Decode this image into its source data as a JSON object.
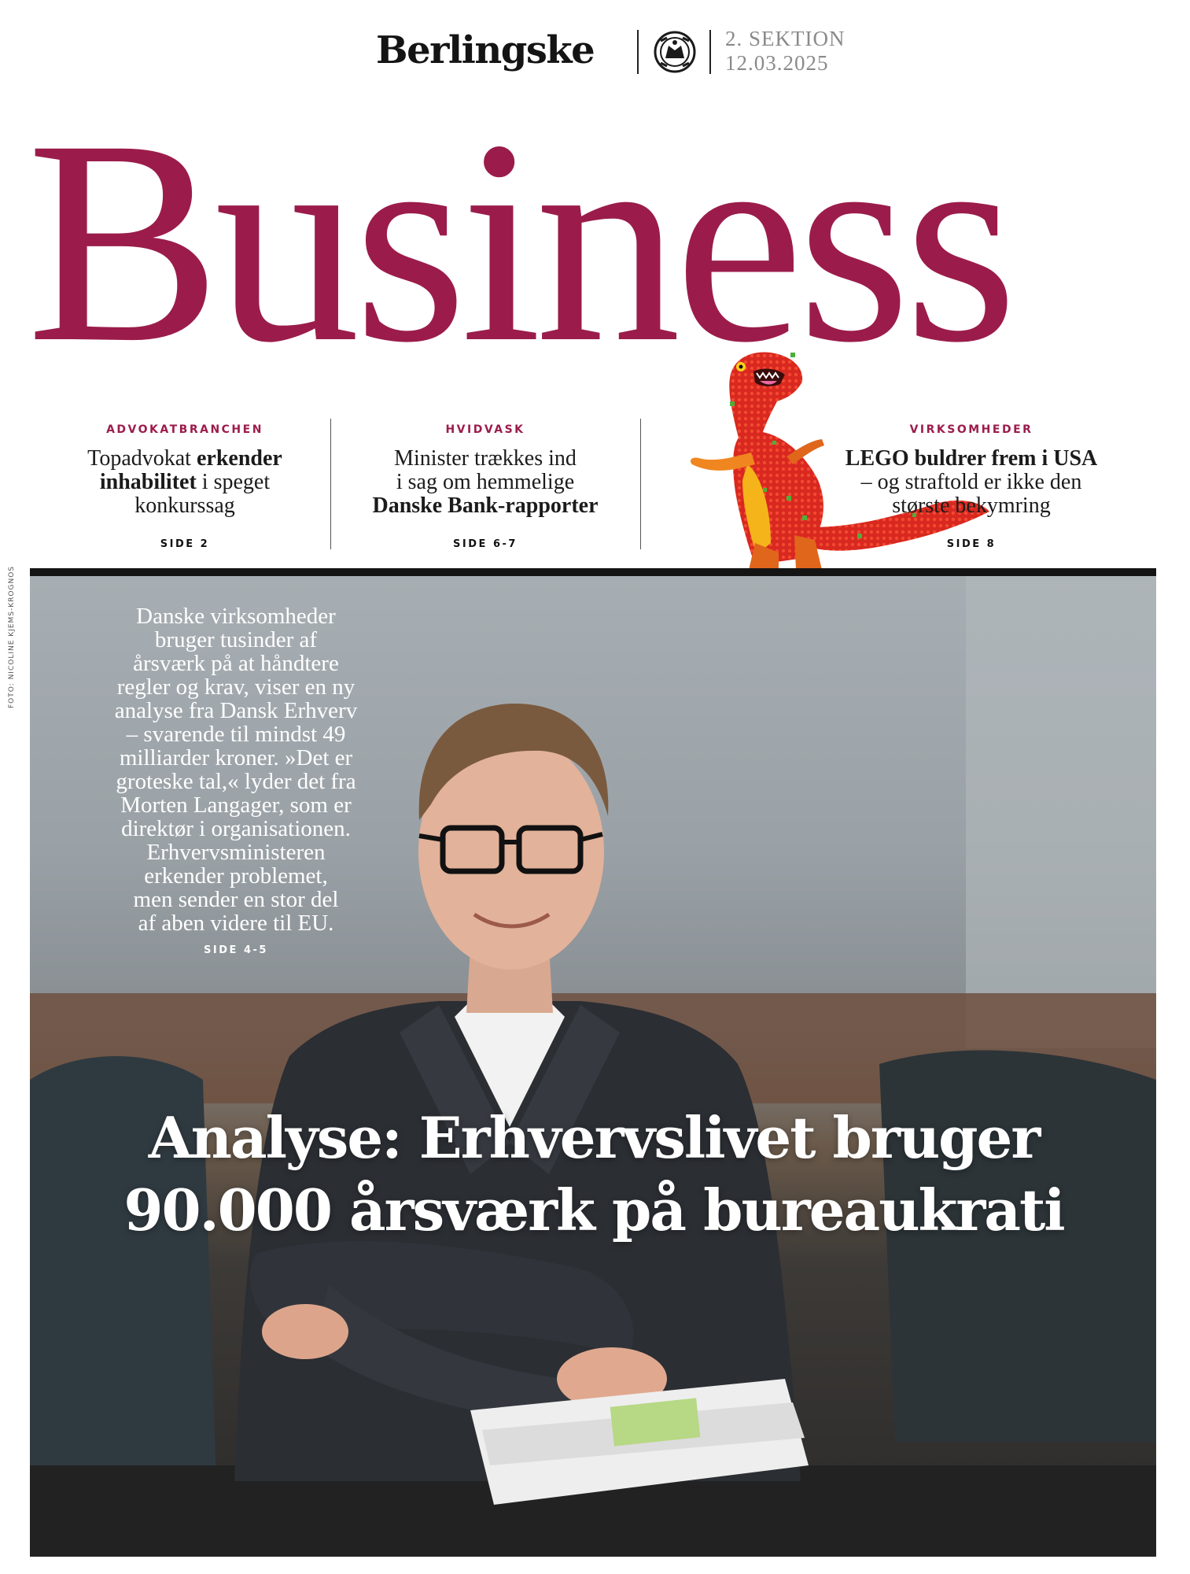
{
  "masthead": {
    "brand": "Berlingske",
    "section": "2. SEKTION",
    "date": "12.03.2025",
    "crest_icon": "coat-of-arms-icon"
  },
  "wordmark": "Business",
  "colors": {
    "accent": "#9b1c4b",
    "text": "#1a1a1a",
    "photo_bar": "#141414"
  },
  "teasers": [
    {
      "kicker": "ADVOKATBRANCHEN",
      "line1_plain": "Topadvokat ",
      "line1_bold": "erkender",
      "line2_bold": "inhabilitet",
      "line2_plain": " i speget",
      "line3": "konkurssag",
      "page": "SIDE 2"
    },
    {
      "kicker": "HVIDVASK",
      "line1": "Minister trækkes ind",
      "line2": "i sag om hemmelige",
      "line3_bold": "Danske Bank-rapporter",
      "page": "SIDE 6-7"
    },
    {
      "kicker": "VIRKSOMHEDER",
      "line1_bold": "LEGO buldrer frem i USA",
      "line2": "– og straftold er ikke den",
      "line3": "største bekymring",
      "page": "SIDE 8"
    }
  ],
  "photo": {
    "credit": "FOTO: NICOLINE KJEMS-KROGNOS",
    "intro_lines": [
      "Danske virksomheder",
      "bruger tusinder af",
      "årsværk på at håndtere",
      "regler og krav, viser en ny",
      "analyse fra Dansk Erhverv",
      "– svarende til mindst 49",
      "milliarder kroner. »Det er",
      "groteske tal,« lyder det fra",
      "Morten Langager, som er",
      "direktør i organisationen.",
      "Erhvervsministeren",
      "erkender problemet,",
      "men sender en stor del",
      "af aben videre til EU."
    ],
    "intro_page": "SIDE 4-5",
    "headline_line1": "Analyse: Erhvervslivet bruger",
    "headline_line2": "90.000 årsværk på bureaukrati"
  }
}
